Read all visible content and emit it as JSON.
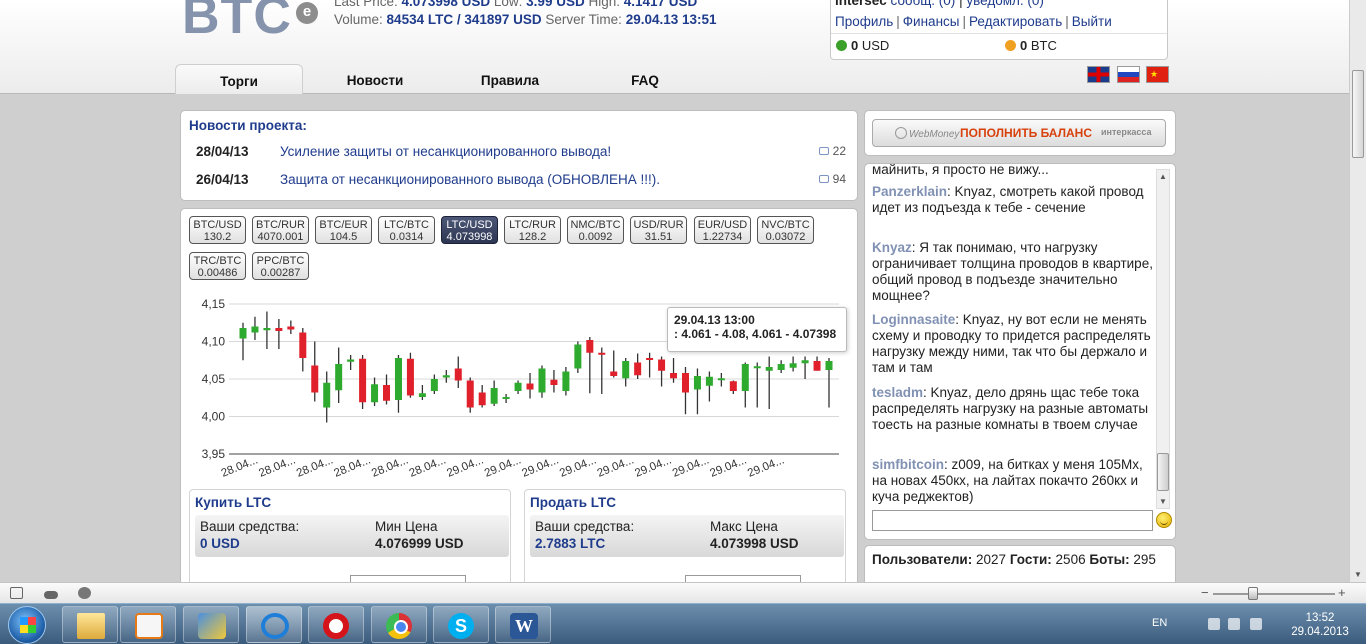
{
  "header": {
    "logo": "BTC",
    "logo_badge": "e",
    "stats1": {
      "last_price_label": "Last Price:",
      "last_price": "4.073998 USD",
      "low_label": "Low:",
      "low": "3.99 USD",
      "high_label": "High:",
      "high": "4.1417 USD"
    },
    "stats2": {
      "volume_label": "Volume:",
      "volume": "84534 LTC / 341897 USD",
      "server_time_label": "Server Time:",
      "server_time": "29.04.13 13:51"
    }
  },
  "user": {
    "name": "intersec",
    "messages": "сообщ. (0)",
    "notifications": "уведомл. (0)",
    "links": [
      "Профиль",
      "Финансы",
      "Редактировать",
      "Выйти"
    ],
    "separator": "|",
    "usd_amount": "0",
    "usd_label": "USD",
    "btc_amount": "0",
    "btc_label": "BTC"
  },
  "flags": [
    "flag-uk",
    "flag-ru",
    "flag-cn"
  ],
  "tabs": [
    "Торги",
    "Новости",
    "Правила",
    "FAQ"
  ],
  "news": {
    "title": "Новости проекта:",
    "items": [
      {
        "date": "28/04/13",
        "text": "Усиление защиты от несанкционированного вывода!",
        "comments": "22"
      },
      {
        "date": "26/04/13",
        "text": "Защита от несанкционированного вывода (ОБНОВЛЕНА !!!).",
        "comments": "94"
      }
    ]
  },
  "pairs": [
    {
      "name": "BTC/USD",
      "price": "130.2"
    },
    {
      "name": "BTC/RUR",
      "price": "4070.001"
    },
    {
      "name": "BTC/EUR",
      "price": "104.5"
    },
    {
      "name": "LTC/BTC",
      "price": "0.0314"
    },
    {
      "name": "LTC/USD",
      "price": "4.073998"
    },
    {
      "name": "LTC/RUR",
      "price": "128.2"
    },
    {
      "name": "NMC/BTC",
      "price": "0.0092"
    },
    {
      "name": "USD/RUR",
      "price": "31.51"
    },
    {
      "name": "EUR/USD",
      "price": "1.22734"
    },
    {
      "name": "NVC/BTC",
      "price": "0.03072"
    },
    {
      "name": "TRC/BTC",
      "price": "0.00486"
    },
    {
      "name": "PPC/BTC",
      "price": "0.00287"
    }
  ],
  "active_pair": "LTC/USD",
  "tooltip": {
    "time": "29.04.13 13:00",
    "values": ": 4.061 - 4.08, 4.061 - 4.07398"
  },
  "chart_data": {
    "type": "candlestick",
    "ylim": [
      3.95,
      4.15
    ],
    "y_ticks": [
      "4,15",
      "4,10",
      "4,05",
      "4,00",
      "3,95"
    ],
    "x_ticks": [
      "28.04...",
      "28.04...",
      "28.04...",
      "28.04...",
      "28.04...",
      "28.04...",
      "29.04...",
      "29.04...",
      "29.04...",
      "29.04...",
      "29.04...",
      "29.04...",
      "29.04...",
      "29.04...",
      "29.04..."
    ],
    "colors": {
      "up": "#2eaa2e",
      "down": "#e0202a"
    },
    "candles": [
      [
        4.104,
        4.118,
        4.125,
        4.075
      ],
      [
        4.112,
        4.12,
        4.133,
        4.102
      ],
      [
        4.115,
        4.118,
        4.14,
        4.09
      ],
      [
        4.118,
        4.114,
        4.13,
        4.09
      ],
      [
        4.12,
        4.116,
        4.128,
        4.11
      ],
      [
        4.112,
        4.078,
        4.118,
        4.06
      ],
      [
        4.068,
        4.032,
        4.1,
        4.02
      ],
      [
        4.012,
        4.045,
        4.06,
        3.992
      ],
      [
        4.035,
        4.07,
        4.092,
        4.018
      ],
      [
        4.073,
        4.076,
        4.082,
        4.062
      ],
      [
        4.077,
        4.019,
        4.082,
        4.01
      ],
      [
        4.019,
        4.043,
        4.052,
        4.014
      ],
      [
        4.042,
        4.021,
        4.056,
        4.016
      ],
      [
        4.022,
        4.078,
        4.082,
        4.005
      ],
      [
        4.077,
        4.028,
        4.085,
        4.025
      ],
      [
        4.026,
        4.031,
        4.042,
        4.022
      ],
      [
        4.034,
        4.05,
        4.056,
        4.03
      ],
      [
        4.052,
        4.055,
        4.062,
        4.045
      ],
      [
        4.064,
        4.048,
        4.08,
        4.038
      ],
      [
        4.048,
        4.012,
        4.052,
        4.005
      ],
      [
        4.032,
        4.015,
        4.042,
        4.012
      ],
      [
        4.017,
        4.038,
        4.048,
        4.014
      ],
      [
        4.024,
        4.026,
        4.03,
        4.018
      ],
      [
        4.034,
        4.045,
        4.048,
        4.03
      ],
      [
        4.044,
        4.036,
        4.058,
        4.024
      ],
      [
        4.032,
        4.064,
        4.068,
        4.025
      ],
      [
        4.049,
        4.042,
        4.062,
        4.032
      ],
      [
        4.034,
        4.06,
        4.066,
        4.028
      ],
      [
        4.064,
        4.096,
        4.1,
        4.058
      ],
      [
        4.102,
        4.085,
        4.106,
        4.031
      ],
      [
        4.085,
        4.084,
        4.092,
        4.03
      ],
      [
        4.06,
        4.054,
        4.088,
        4.052
      ],
      [
        4.051,
        4.074,
        4.078,
        4.04
      ],
      [
        4.072,
        4.055,
        4.084,
        4.05
      ],
      [
        4.078,
        4.076,
        4.085,
        4.052
      ],
      [
        4.076,
        4.061,
        4.08,
        4.04
      ],
      [
        4.058,
        4.051,
        4.078,
        4.045
      ],
      [
        4.058,
        4.032,
        4.066,
        4.003
      ],
      [
        4.036,
        4.054,
        4.064,
        4.003
      ],
      [
        4.041,
        4.053,
        4.06,
        4.02
      ],
      [
        4.05,
        4.051,
        4.058,
        4.04
      ],
      [
        4.047,
        4.034,
        4.048,
        4.03
      ],
      [
        4.034,
        4.07,
        4.072,
        4.012
      ],
      [
        4.066,
        4.067,
        4.072,
        4.012
      ],
      [
        4.061,
        4.066,
        4.08,
        4.01
      ],
      [
        4.062,
        4.07,
        4.075,
        4.058
      ],
      [
        4.065,
        4.071,
        4.08,
        4.06
      ],
      [
        4.071,
        4.075,
        4.08,
        4.05
      ],
      [
        4.074,
        4.061,
        4.08,
        4.061
      ],
      [
        4.062,
        4.074,
        4.078,
        4.012
      ]
    ]
  },
  "buy": {
    "title": "Купить LTC",
    "funds_label": "Ваши средства:",
    "funds": "0 USD",
    "price_label": "Мин Цена",
    "price": "4.076999 USD"
  },
  "sell": {
    "title": "Продать LTC",
    "funds_label": "Ваши средства:",
    "funds": "2.7883 LTC",
    "price_label": "Макс Цена",
    "price": "4.073998 USD"
  },
  "payment": {
    "left": "WebMoney",
    "label": "ПОПОЛНИТЬ БАЛАНС",
    "right": "интеркасса"
  },
  "chat": {
    "messages": [
      {
        "nick": "",
        "text": "майнить, я просто не вижу..."
      },
      {
        "nick": "Panzerklain",
        "text": ": Knyaz, смотреть какой провод идет из подъезда к тебе - сечение"
      },
      {
        "nick": "Knyaz",
        "text": ": Я так понимаю, что нагрузку ограничивает толщина проводов в квартире, общий провод в подъезде значительно мощнее?"
      },
      {
        "nick": "Loginnasaite",
        "text": ": Knyaz, ну вот если не менять схему и проводку то придется распределять нагрузку между ними, так что бы держало и там и там"
      },
      {
        "nick": "tesladm",
        "text": ": Knyaz, дело дрянь щас тебе тока распределять нагрузку на разные автоматы тоесть на разные комнаты в твоем случае"
      },
      {
        "nick": "simfbitcoin",
        "text": ": z009, на битках у меня 105Мх, на новах 450кх, на лайтах покачто 260кх и куча реджектов)"
      }
    ]
  },
  "users": {
    "users_label": "Пользователи:",
    "users": "2027",
    "guests_label": "Гости:",
    "guests": "2506",
    "bots_label": "Боты:",
    "bots": "295"
  },
  "taskbar": {
    "lang": "EN",
    "time": "13:52",
    "date": "29.04.2013"
  }
}
